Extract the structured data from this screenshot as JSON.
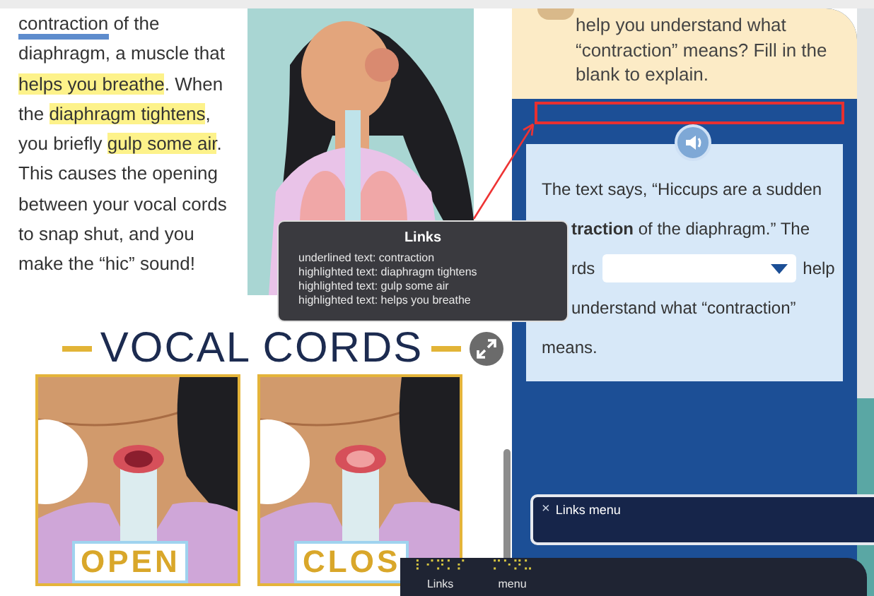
{
  "book_page": {
    "paragraph_lines": [
      [
        {
          "text": "contraction",
          "kind": "underlined"
        },
        {
          "text": " of the",
          "kind": "plain"
        }
      ],
      [
        {
          "text": "diaphragm, a muscle that",
          "kind": "plain"
        }
      ],
      [
        {
          "text": "helps you breathe",
          "kind": "highlighted"
        },
        {
          "text": ". When",
          "kind": "plain"
        }
      ],
      [
        {
          "text": "the ",
          "kind": "plain"
        },
        {
          "text": "diaphragm tightens",
          "kind": "highlighted"
        },
        {
          "text": ",",
          "kind": "plain"
        }
      ],
      [
        {
          "text": "you briefly ",
          "kind": "plain"
        },
        {
          "text": "gulp some air",
          "kind": "highlighted"
        },
        {
          "text": ".",
          "kind": "plain"
        }
      ],
      [
        {
          "text": "This causes the opening",
          "kind": "plain"
        }
      ],
      [
        {
          "text": "between your vocal cords",
          "kind": "plain"
        }
      ],
      [
        {
          "text": "to snap shut, and you",
          "kind": "plain"
        }
      ],
      [
        {
          "text": "make the “hic” sound!",
          "kind": "plain"
        }
      ]
    ],
    "heading": "VOCAL CORDS",
    "panels": [
      {
        "label": "OPEN",
        "kind": "open"
      },
      {
        "label": "CLOS",
        "kind": "closed"
      }
    ]
  },
  "question_card": {
    "lines": [
      "help you understand what",
      "“contraction” means? Fill in the",
      "blank to explain."
    ]
  },
  "answer_card": {
    "lines": [
      {
        "kind": "text",
        "text": "The text says, “Hiccups are a sudden",
        "occluded": false
      },
      {
        "kind": "text",
        "text": "**traction** of the diaphragm.” The",
        "occluded": true
      },
      {
        "kind": "blank",
        "before": "rds",
        "after": "help",
        "occluded": true
      },
      {
        "kind": "text",
        "text": "understand what “contraction”",
        "occluded": true
      },
      {
        "kind": "text",
        "text": "means.",
        "occluded": false
      }
    ]
  },
  "links_tooltip": {
    "title": "Links",
    "items": [
      "underlined text: contraction",
      "highlighted text: diaphragm tightens",
      "highlighted text: gulp some air",
      "highlighted text: helps you breathe"
    ]
  },
  "links_menu": {
    "close": "×",
    "label": "Links menu"
  },
  "braille_bar": {
    "cells": [
      {
        "braille": "⠇⠊⠝⠅⠎",
        "label": "Links"
      },
      {
        "braille": "⠍⠑⠝⠥",
        "label": "menu"
      }
    ]
  }
}
